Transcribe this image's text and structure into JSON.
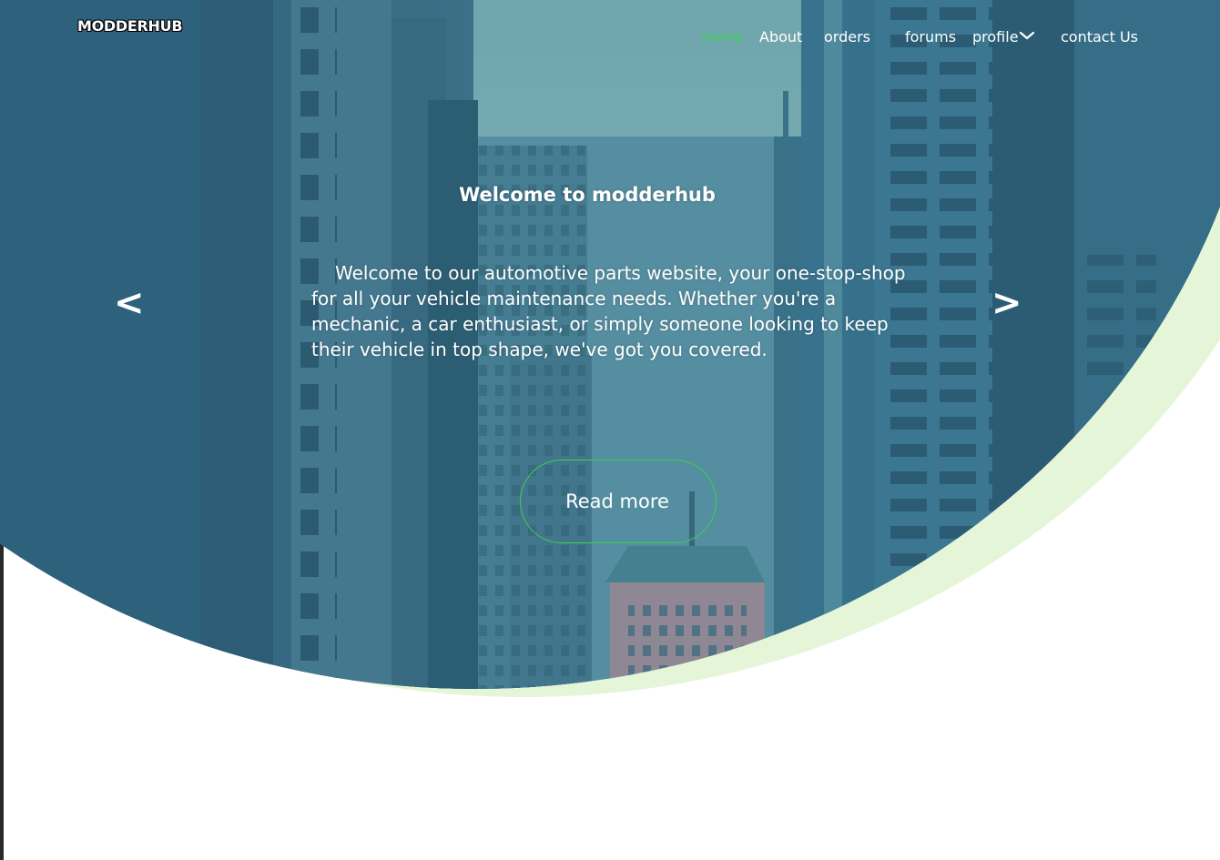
{
  "brand": {
    "name": "MODDERHUB"
  },
  "nav": {
    "items": [
      {
        "label": "home",
        "active": true
      },
      {
        "label": "About"
      },
      {
        "label": "orders"
      },
      {
        "label": "forums"
      },
      {
        "label": "profile",
        "has_dropdown": true
      },
      {
        "label": "contact Us"
      }
    ]
  },
  "hero": {
    "title": "Welcome to modderhub",
    "description": "Welcome to our automotive parts website, your one-stop-shop for all your vehicle maintenance needs. Whether you're a mechanic, a car enthusiast, or simply someone looking to keep their vehicle in top shape, we've got you covered.",
    "prev_label": "<",
    "next_label": ">",
    "cta_label": "Read more"
  },
  "colors": {
    "accent": "#3ed05a",
    "hero_tint": "#3e7387",
    "accent_wave": "#e5f5d8",
    "text": "#ffffff"
  },
  "icons": {
    "profile_dropdown": "chevron-down-icon",
    "prev": "chevron-left-icon",
    "next": "chevron-right-icon"
  }
}
